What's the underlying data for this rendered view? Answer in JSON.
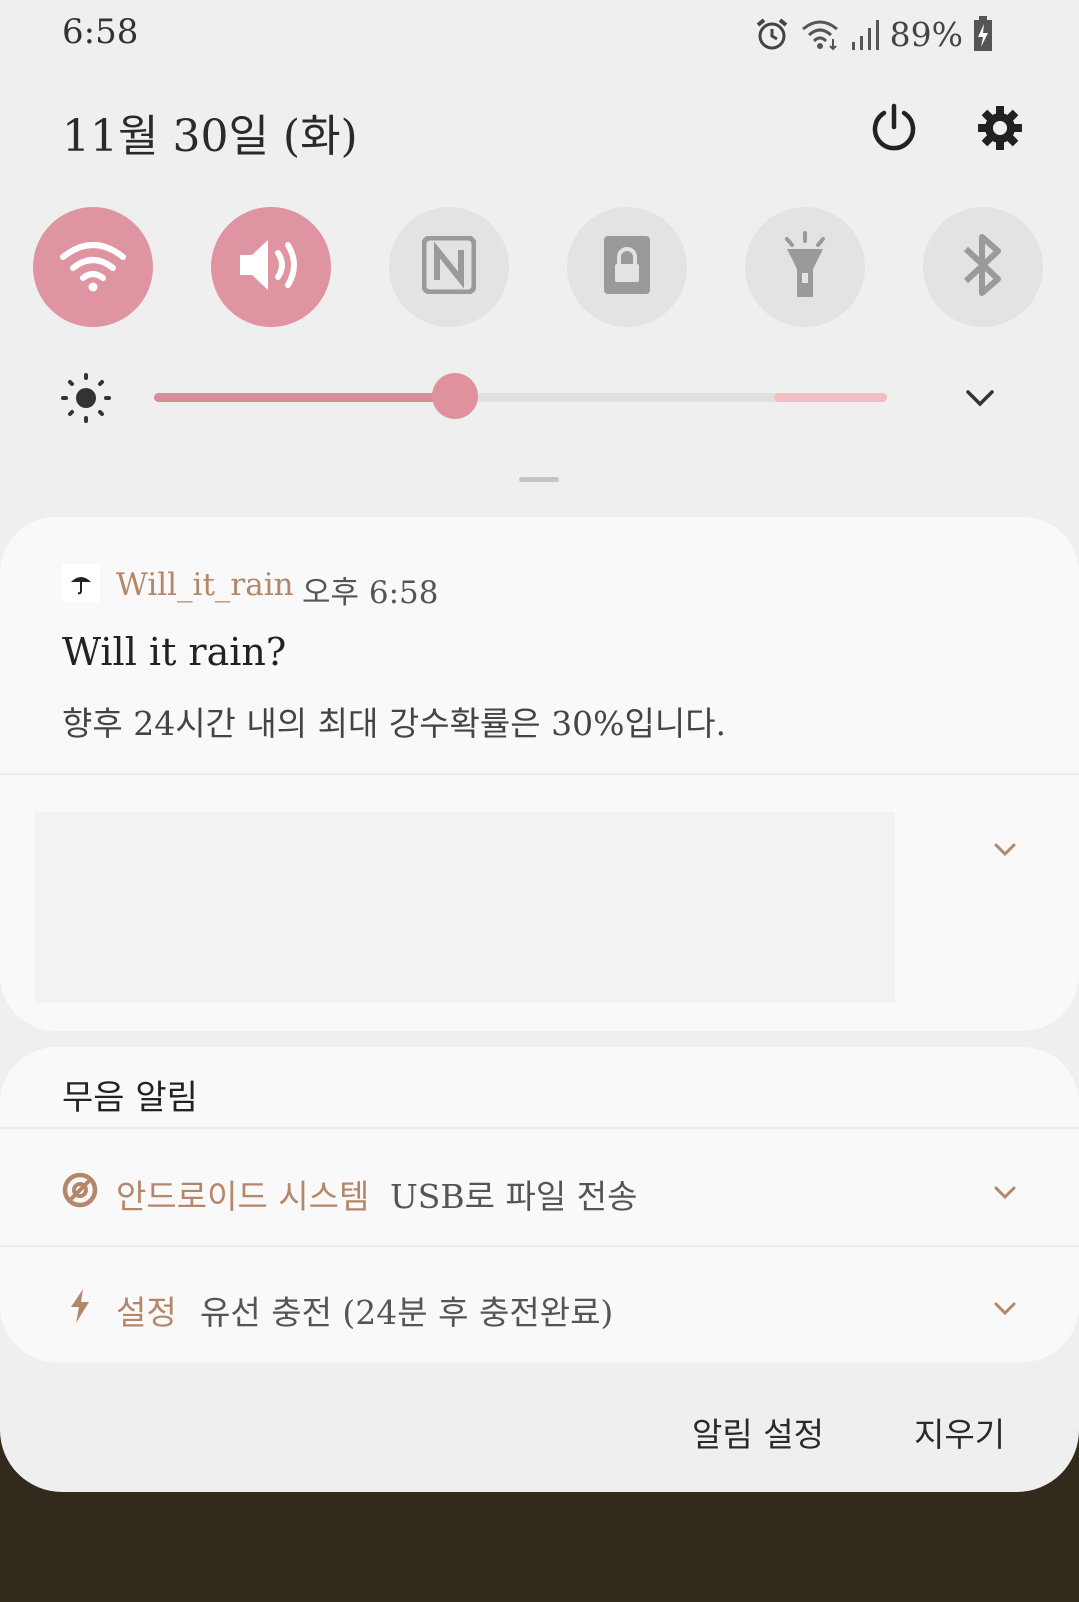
{
  "status_bar": {
    "time": "6:58",
    "battery_percent": "89%",
    "icons": [
      "alarm-icon",
      "wifi-icon",
      "signal-icon",
      "battery-charging-icon"
    ]
  },
  "header": {
    "date": "11월 30일 (화)",
    "icons": [
      "power-icon",
      "settings-icon"
    ]
  },
  "quick_settings": [
    {
      "name": "wifi",
      "icon": "wifi-icon",
      "active": true
    },
    {
      "name": "sound",
      "icon": "volume-icon",
      "active": true
    },
    {
      "name": "nfc",
      "icon": "nfc-icon",
      "active": false
    },
    {
      "name": "screen-lock",
      "icon": "lock-icon",
      "active": false
    },
    {
      "name": "flashlight",
      "icon": "flashlight-icon",
      "active": false
    },
    {
      "name": "bluetooth",
      "icon": "bluetooth-icon",
      "active": false
    }
  ],
  "brightness": {
    "level": 0.41,
    "icon": "brightness-icon"
  },
  "colors": {
    "accent": "#df94a1",
    "app_name": "#b5876a",
    "background": "#efefef"
  },
  "notification": {
    "app_name": "Will_it_rain",
    "time": "오후 6:58",
    "title": "Will it rain?",
    "body": "향후 24시간 내의 최대 강수확률은 30%입니다."
  },
  "silent": {
    "header": "무음 알림",
    "items": [
      {
        "app": "안드로이드 시스템",
        "text": "USB로 파일 전송",
        "icon": "android-system-icon"
      },
      {
        "app": "설정",
        "text": "유선 충전 (24분 후 충전완료)",
        "icon": "charging-bolt-icon"
      }
    ]
  },
  "footer": {
    "notification_settings": "알림 설정",
    "clear": "지우기"
  }
}
